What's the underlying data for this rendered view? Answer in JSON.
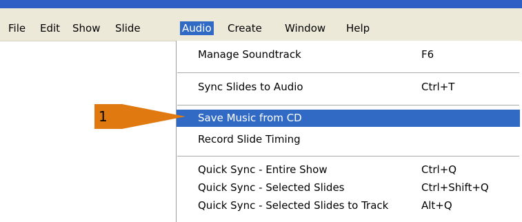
{
  "menubar": {
    "items": [
      {
        "label": "File"
      },
      {
        "label": "Edit"
      },
      {
        "label": "Show"
      },
      {
        "label": "Slide"
      },
      {
        "label": "Audio"
      },
      {
        "label": "Create"
      },
      {
        "label": "Window"
      },
      {
        "label": "Help"
      }
    ],
    "active": "Audio"
  },
  "dropdown": {
    "items": [
      {
        "label": "Manage Soundtrack",
        "shortcut": "F6"
      },
      {
        "label": "Sync Slides to Audio",
        "shortcut": "Ctrl+T"
      },
      {
        "label": "Save Music from CD",
        "shortcut": "",
        "highlighted": true
      },
      {
        "label": "Record Slide Timing",
        "shortcut": ""
      },
      {
        "label": "Quick Sync - Entire Show",
        "shortcut": "Ctrl+Q"
      },
      {
        "label": "Quick Sync - Selected Slides",
        "shortcut": "Ctrl+Shift+Q"
      },
      {
        "label": "Quick Sync - Selected Slides to Track",
        "shortcut": "Alt+Q"
      }
    ]
  },
  "callout": {
    "number": "1",
    "color": "#e07a10"
  },
  "colors": {
    "highlight": "#316ac5",
    "menubar_bg": "#ece9d8",
    "title_strip": "#2f5fc4"
  }
}
